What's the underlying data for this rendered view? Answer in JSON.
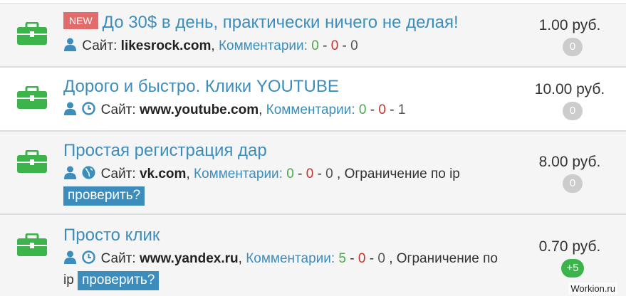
{
  "tasks": [
    {
      "badge": "NEW",
      "title": "До 30$ в день, практически ничего не делая!",
      "site_label": "Сайт:",
      "domain": "likesrock.com",
      "comments_label": "Комментарии:",
      "c_good": "0",
      "sep1": "-",
      "c_bad": "0",
      "sep2": "-",
      "c_neutral": "0",
      "price": "1.00 руб.",
      "counter": "0"
    },
    {
      "title": "Дорого и быстро. Клики YOUTUBE",
      "site_label": "Сайт:",
      "domain": "www.youtube.com",
      "comments_label": "Комментарии:",
      "c_good": "0",
      "sep1": "-",
      "c_bad": "0",
      "sep2": "-",
      "c_neutral": "1",
      "price": "10.00 руб.",
      "counter": "0"
    },
    {
      "title": "Простая регистрация дар",
      "site_label": "Сайт:",
      "domain": "vk.com",
      "comments_label": "Комментарии:",
      "c_good": "0",
      "sep1": "-",
      "c_bad": "0",
      "sep2": "-",
      "c_neutral": "0",
      "restriction": ", Ограничение по ip",
      "check_button": "проверить?",
      "price": "8.00 руб.",
      "counter": "0"
    },
    {
      "title": "Просто клик",
      "site_label": "Сайт:",
      "domain": "www.yandex.ru",
      "comments_label": "Комментарии:",
      "c_good": "5",
      "sep1": "-",
      "c_bad": "0",
      "sep2": "-",
      "c_neutral": "0",
      "restriction": ", Ограничение по",
      "restriction_tail": "ip",
      "check_button": "проверить?",
      "price": "0.70 руб.",
      "counter": "+5"
    }
  ],
  "icons": {
    "task": "briefcase-icon",
    "user": "user-icon",
    "clock": "clock-icon",
    "globe": "globe-icon"
  },
  "colors": {
    "link": "#3c8dbc",
    "new_badge": "#e26b6b",
    "briefcase": "#3cb44b",
    "good": "#4aa84a",
    "bad": "#c9302c",
    "counter_gray": "#cccccc",
    "counter_green": "#3cb44b"
  },
  "watermark": "Workion.ru"
}
